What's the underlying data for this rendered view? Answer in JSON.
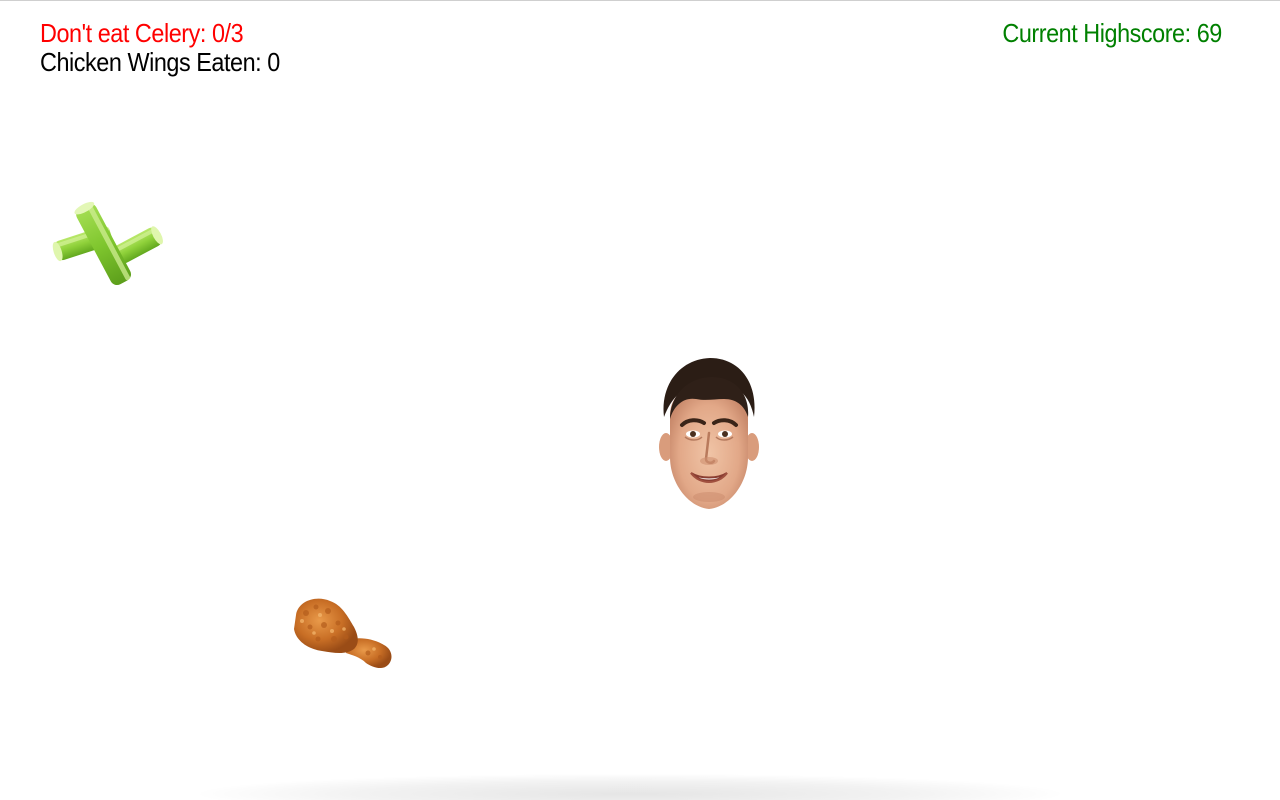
{
  "hud": {
    "celery_text": "Don't eat Celery: 0/3",
    "wings_text": "Chicken Wings Eaten: 0",
    "highscore_text": "Current Highscore: 69"
  },
  "colors": {
    "celery_counter": "#ff0000",
    "wings_counter": "#000000",
    "highscore": "#008000",
    "background": "#ffffff"
  },
  "game_state": {
    "celery_eaten": 0,
    "celery_limit": 3,
    "wings_eaten": 0,
    "highscore": 69
  },
  "sprites": {
    "celery": "celery-sprite",
    "player": "player-face",
    "chicken": "chicken-sprite"
  }
}
